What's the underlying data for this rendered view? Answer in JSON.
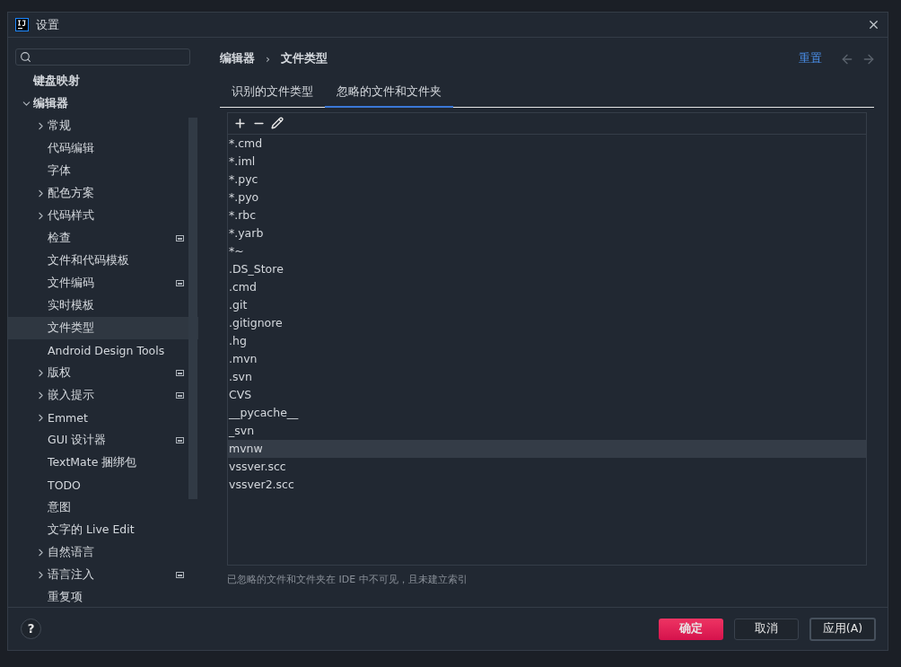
{
  "window": {
    "title": "设置"
  },
  "sidebar": {
    "items": [
      {
        "label": "键盘映射",
        "selected": false
      },
      {
        "label": "编辑器",
        "selected": false,
        "expanded": true,
        "children": [
          {
            "label": "常规",
            "selected": false,
            "expanded": false,
            "badge": false
          },
          {
            "label": "代码编辑",
            "selected": false,
            "badge": false
          },
          {
            "label": "字体",
            "selected": false,
            "badge": false
          },
          {
            "label": "配色方案",
            "selected": false,
            "expanded": false,
            "badge": false
          },
          {
            "label": "代码样式",
            "selected": false,
            "expanded": false,
            "badge": false
          },
          {
            "label": "检查",
            "selected": false,
            "badge": true
          },
          {
            "label": "文件和代码模板",
            "selected": false,
            "badge": false
          },
          {
            "label": "文件编码",
            "selected": false,
            "badge": true
          },
          {
            "label": "实时模板",
            "selected": false,
            "badge": false
          },
          {
            "label": "文件类型",
            "selected": true,
            "badge": false
          },
          {
            "label": "Android Design Tools",
            "selected": false,
            "badge": false
          },
          {
            "label": "版权",
            "selected": false,
            "expanded": false,
            "badge": true
          },
          {
            "label": "嵌入提示",
            "selected": false,
            "expanded": false,
            "badge": true
          },
          {
            "label": "Emmet",
            "selected": false,
            "expanded": false,
            "badge": false
          },
          {
            "label": "GUI 设计器",
            "selected": false,
            "badge": true
          },
          {
            "label": "TextMate 捆绑包",
            "selected": false,
            "badge": false
          },
          {
            "label": "TODO",
            "selected": false,
            "badge": false
          },
          {
            "label": "意图",
            "selected": false,
            "badge": false
          },
          {
            "label": "文字的 Live Edit",
            "selected": false,
            "badge": false
          },
          {
            "label": "自然语言",
            "selected": false,
            "expanded": false,
            "badge": false
          },
          {
            "label": "语言注入",
            "selected": false,
            "expanded": false,
            "badge": true
          },
          {
            "label": "重复项",
            "selected": false,
            "badge": false
          }
        ]
      }
    ]
  },
  "breadcrumb": [
    "编辑器",
    "文件类型"
  ],
  "breadcrumb_separator": "›",
  "reset_link": "重置",
  "tabs": [
    {
      "label": "识别的文件类型",
      "selected": false
    },
    {
      "label": "忽略的文件和文件夹",
      "selected": true
    }
  ],
  "list": {
    "items": [
      {
        "text": "*.cmd",
        "selected": false
      },
      {
        "text": "*.iml",
        "selected": false
      },
      {
        "text": "*.pyc",
        "selected": false
      },
      {
        "text": "*.pyo",
        "selected": false
      },
      {
        "text": "*.rbc",
        "selected": false
      },
      {
        "text": "*.yarb",
        "selected": false
      },
      {
        "text": "*~",
        "selected": false
      },
      {
        "text": ".DS_Store",
        "selected": false
      },
      {
        "text": ".cmd",
        "selected": false
      },
      {
        "text": ".git",
        "selected": false
      },
      {
        "text": ".gitignore",
        "selected": false
      },
      {
        "text": ".hg",
        "selected": false
      },
      {
        "text": ".mvn",
        "selected": false
      },
      {
        "text": ".svn",
        "selected": false
      },
      {
        "text": "CVS",
        "selected": false
      },
      {
        "text": "__pycache__",
        "selected": false
      },
      {
        "text": "_svn",
        "selected": false
      },
      {
        "text": "mvnw",
        "selected": true
      },
      {
        "text": "vssver.scc",
        "selected": false
      },
      {
        "text": "vssver2.scc",
        "selected": false
      }
    ]
  },
  "caption": "已忽略的文件和文件夹在 IDE 中不可见，且未建立索引",
  "help_button": "?",
  "buttons": [
    {
      "label": "确定",
      "kind": "primary"
    },
    {
      "label": "取消",
      "kind": "plain"
    },
    {
      "label": "应用(A)",
      "kind": "focused"
    }
  ]
}
